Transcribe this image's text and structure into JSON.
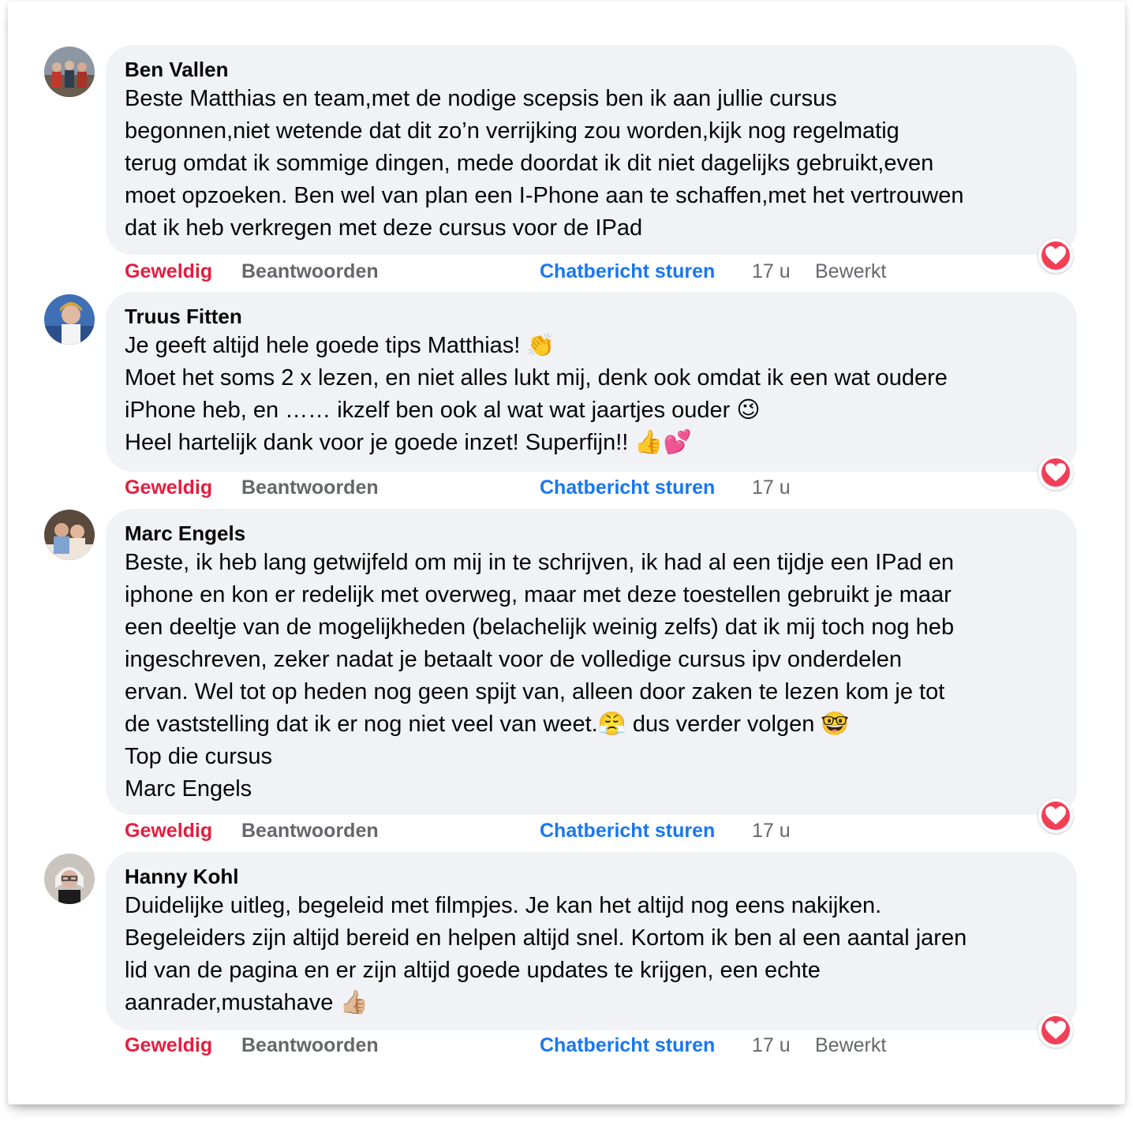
{
  "comments": [
    {
      "author": "Ben Vallen",
      "lines": [
        "Beste Matthias en team,met de nodige scepsis ben ik aan jullie cursus",
        "begonnen,niet wetende dat dit zo’n verrijking zou worden,kijk nog regelmatig",
        "terug omdat ik sommige dingen, mede doordat ik dit niet dagelijks gebruikt,even",
        "moet opzoeken. Ben wel van plan een I-Phone aan te schaffen,met het vertrouwen",
        "dat ik heb verkregen met deze cursus voor de IPad"
      ],
      "love": "Geweldig",
      "reply": "Beantwoorden",
      "chat": "Chatbericht sturen",
      "time": "17 u",
      "edited": "Bewerkt",
      "reaction_icon": "heart-icon",
      "avatar_color": "#6d7a8a"
    },
    {
      "author": "Truus Fitten",
      "lines": [
        "Je geeft altijd hele goede tips Matthias! 👏",
        "Moet het soms 2 x lezen, en niet alles lukt mij, denk ook omdat ik een wat oudere",
        "iPhone heb, en …… ikzelf ben ook al wat wat jaartjes ouder 😉",
        "Heel hartelijk dank voor je goede inzet! Superfijn!! 👍💕"
      ],
      "love": "Geweldig",
      "reply": "Beantwoorden",
      "chat": "Chatbericht sturen",
      "time": "17 u",
      "reaction_icon": "heart-icon",
      "avatar_color": "#3f6fb5"
    },
    {
      "author": "Marc Engels",
      "lines": [
        "Beste, ik heb lang getwijfeld om mij in te schrijven, ik had al een tijdje een IPad en",
        "iphone en kon er redelijk met overweg, maar met deze toestellen gebruikt je maar",
        "een deeltje van de mogelijkheden (belachelijk weinig zelfs) dat ik mij toch nog heb",
        "ingeschreven, zeker nadat je betaalt voor de volledige cursus ipv onderdelen",
        "ervan. Wel tot op heden nog geen spijt van, alleen door zaken te lezen kom je tot",
        "de vaststelling dat ik er nog niet veel van weet.😤 dus verder volgen 🤓",
        "Top die cursus",
        "Marc Engels"
      ],
      "love": "Geweldig",
      "reply": "Beantwoorden",
      "chat": "Chatbericht sturen",
      "time": "17 u",
      "reaction_icon": "heart-icon",
      "avatar_color": "#5a4a3e"
    },
    {
      "author": "Hanny Kohl",
      "lines": [
        "Duidelijke uitleg, begeleid met filmpjes. Je kan het altijd nog eens nakijken.",
        "Begeleiders zijn altijd bereid en helpen altijd snel. Kortom ik ben al een aantal jaren",
        "lid van de pagina en er zijn altijd goede updates te krijgen, een echte",
        "aanrader,mustahave 👍🏼"
      ],
      "love": "Geweldig",
      "reply": "Beantwoorden",
      "chat": "Chatbericht sturen",
      "time": "17 u",
      "edited": "Bewerkt",
      "reaction_icon": "heart-icon",
      "avatar_color": "#b9b4ad"
    }
  ],
  "colors": {
    "bubble_bg": "#f0f2f5",
    "love_red": "#e41e3f",
    "link_blue": "#1877f2",
    "meta_gray": "#65676b"
  }
}
